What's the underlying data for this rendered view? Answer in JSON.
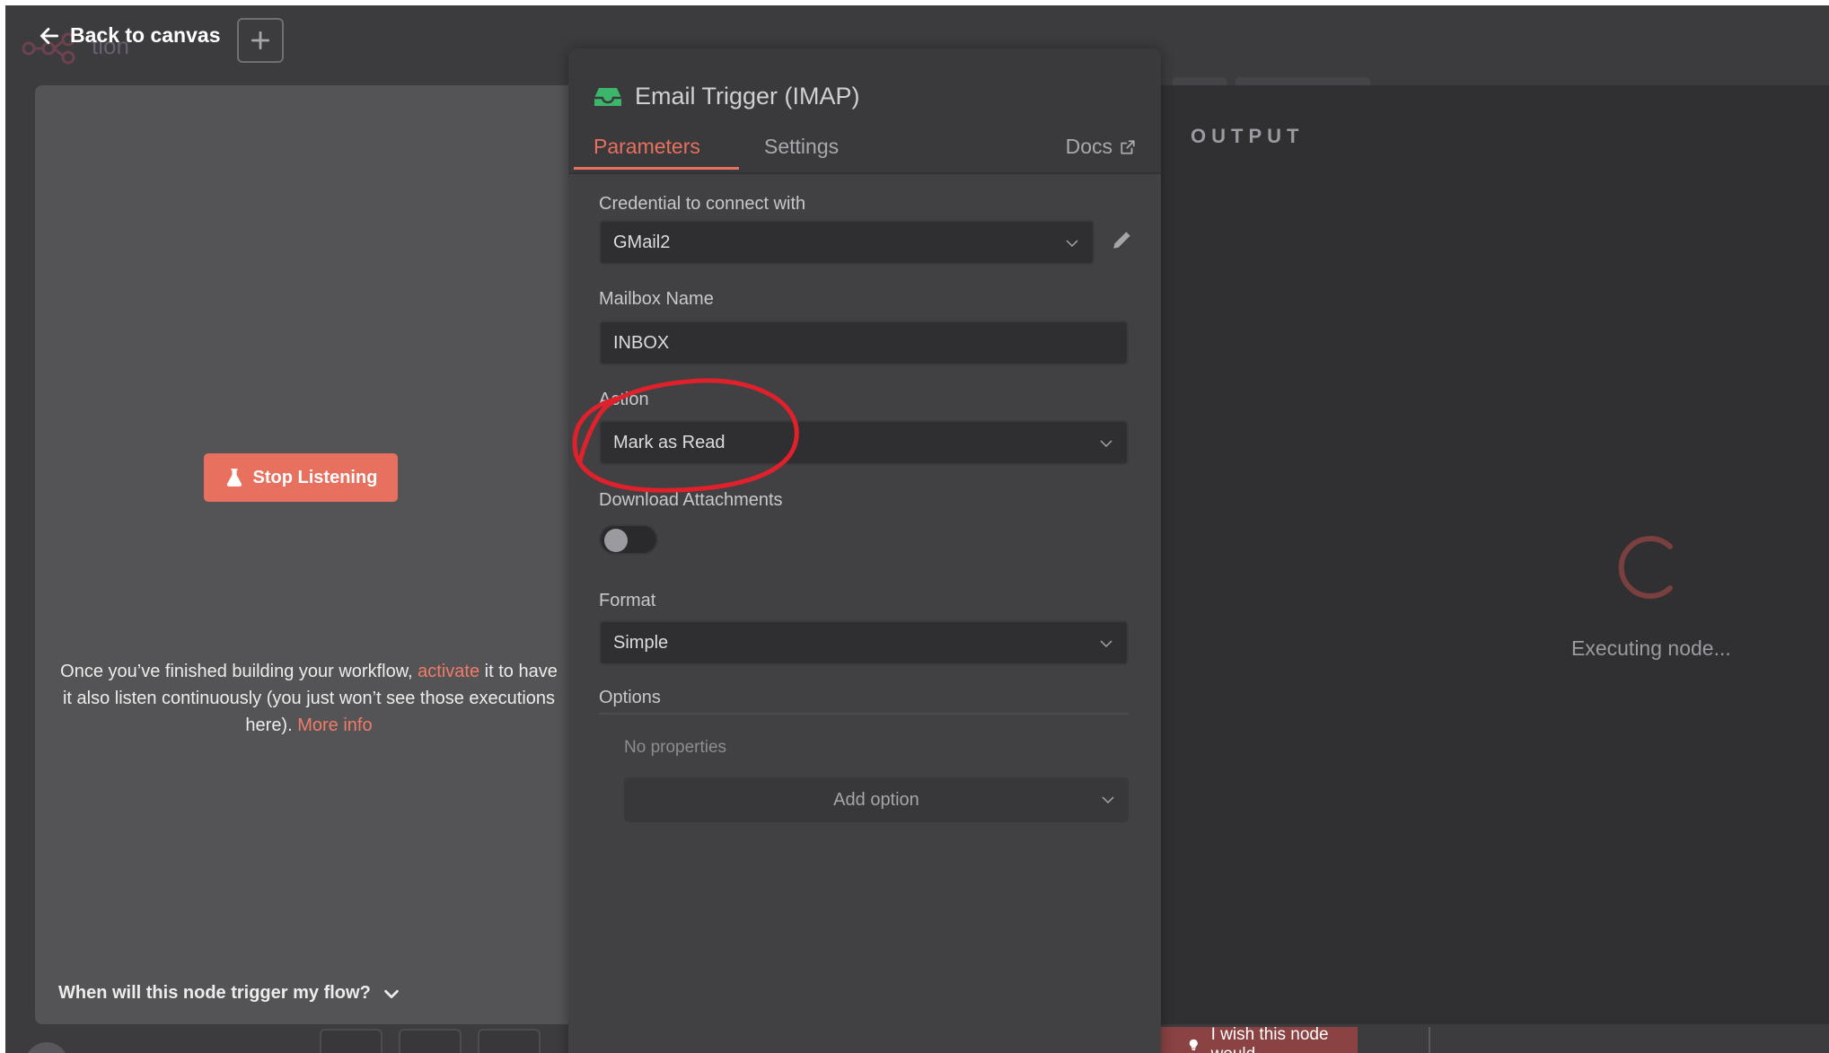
{
  "canvas_bg": {
    "title_fragment": "tion"
  },
  "header": {
    "back_label": "Back to canvas",
    "plus_icon": "plus-icon"
  },
  "left_panel": {
    "stop_button_label": "Stop Listening",
    "info_prefix": "Once you’ve finished building your workflow, ",
    "info_activate": "activate",
    "info_middle": " it to have it also listen continuously (you just won’t see those executions here). ",
    "info_more": "More info",
    "trigger_question": "When will this node trigger my flow?"
  },
  "node": {
    "title": "Email Trigger (IMAP)",
    "tabs": [
      {
        "label": "Parameters",
        "active": true
      },
      {
        "label": "Settings",
        "active": false
      }
    ],
    "docs_label": "Docs",
    "fields": {
      "credential_label": "Credential to connect with",
      "credential_value": "GMail2",
      "mailbox_label": "Mailbox Name",
      "mailbox_value": "INBOX",
      "action_label": "Action",
      "action_value": "Mark as Read",
      "download_label": "Download Attachments",
      "download_enabled": false,
      "format_label": "Format",
      "format_value": "Simple",
      "options_label": "Options",
      "no_properties": "No properties",
      "add_option_label": "Add option"
    }
  },
  "output": {
    "label": "OUTPUT",
    "status": "Executing node..."
  },
  "feedback": {
    "label": "I wish this node would..."
  },
  "colors": {
    "accent": "#e8705e",
    "panel_bg": "#414144",
    "output_bg": "#303032",
    "input_bg": "#545456",
    "annotation": "#e0202a",
    "icon_green": "#3bb66a"
  }
}
